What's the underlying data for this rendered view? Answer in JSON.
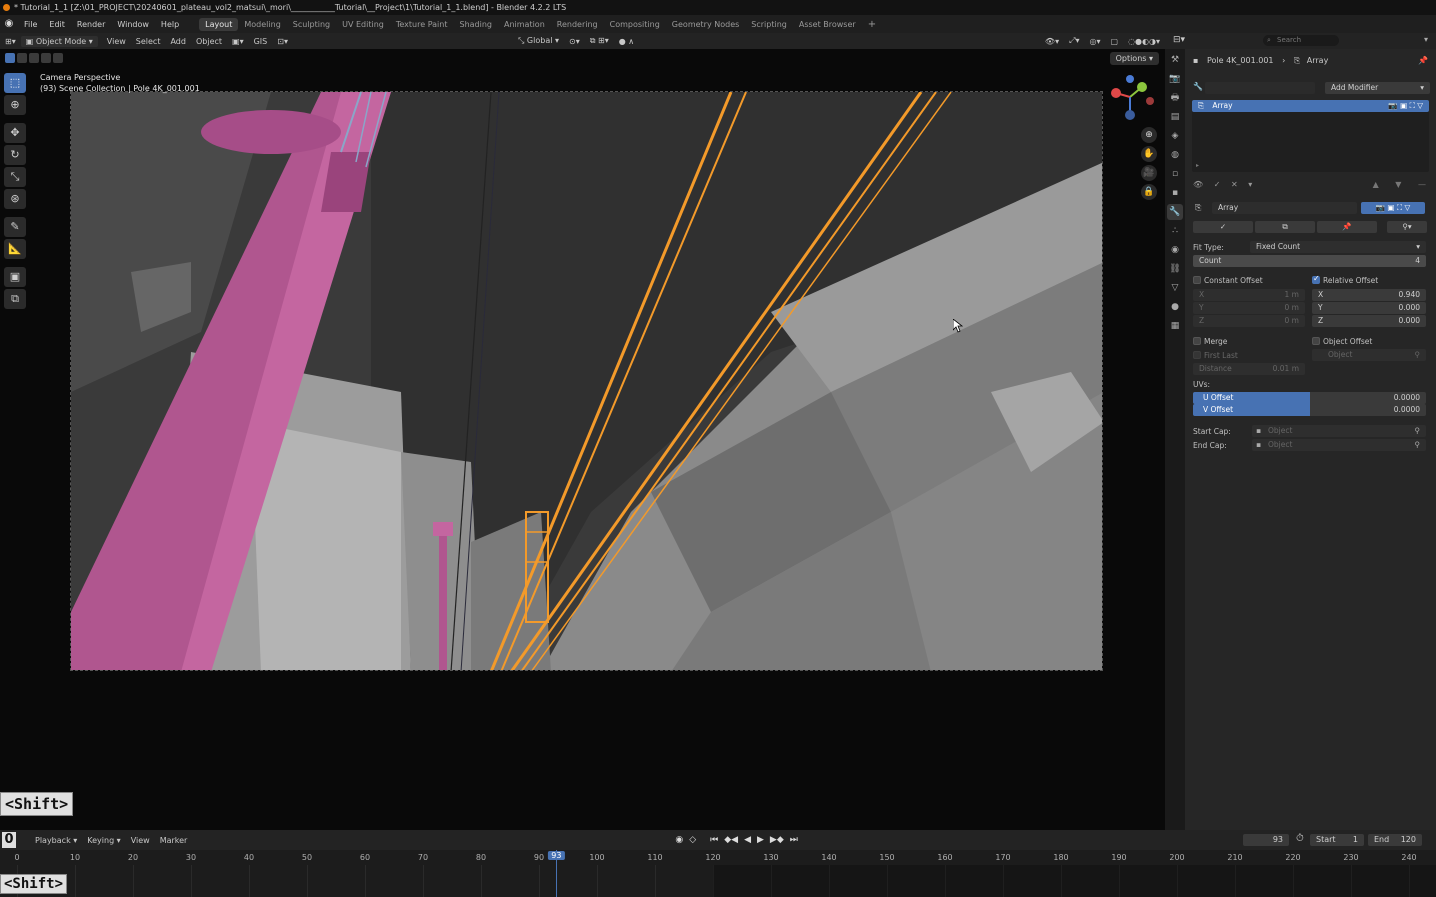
{
  "titlebar": {
    "title": "* Tutorial_1_1 [Z:\\01_PROJECT\\20240601_plateau_vol2_matsui\\_mori\\___________Tutorial\\__Project\\1\\Tutorial_1_1.blend] - Blender 4.2.2 LTS"
  },
  "menu": [
    "File",
    "Edit",
    "Render",
    "Window",
    "Help"
  ],
  "workspaces": [
    "Layout",
    "Modeling",
    "Sculpting",
    "UV Editing",
    "Texture Paint",
    "Shading",
    "Animation",
    "Rendering",
    "Compositing",
    "Geometry Nodes",
    "Scripting",
    "Asset Browser"
  ],
  "active_workspace": "Layout",
  "viewport_header": {
    "mode": "Object Mode",
    "menus": [
      "View",
      "Select",
      "Add",
      "Object",
      "GIS"
    ],
    "orientation": "Global",
    "options": "Options"
  },
  "viewport": {
    "info_line1": "Camera Perspective",
    "info_line2": "(93) Scene Collection | Pole 4K_001.001"
  },
  "outliner_header": {
    "search_placeholder": "Search"
  },
  "properties": {
    "breadcrumb_object": "Pole 4K_001.001",
    "breadcrumb_modifier": "Array",
    "add_modifier": "Add Modifier",
    "stack_item": "Array",
    "modifier_name": "Array",
    "fit_type_label": "Fit Type:",
    "fit_type_value": "Fixed Count",
    "count_label": "Count",
    "count_value": "4",
    "constant_offset": "Constant Offset",
    "relative_offset": "Relative Offset",
    "const_x_label": "X",
    "const_x_value": "1 m",
    "const_y_label": "Y",
    "const_y_value": "0 m",
    "const_z_label": "Z",
    "const_z_value": "0 m",
    "rel_x_label": "X",
    "rel_x_value": "0.940",
    "rel_y_label": "Y",
    "rel_y_value": "0.000",
    "rel_z_label": "Z",
    "rel_z_value": "0.000",
    "merge": "Merge",
    "first_last": "First Last",
    "distance_label": "Distance",
    "distance_value": "0.01 m",
    "object_offset": "Object Offset",
    "object_placeholder": "Object",
    "uvs_label": "UVs:",
    "u_offset_label": "U Offset",
    "u_offset_value": "0.0000",
    "v_offset_label": "V Offset",
    "v_offset_value": "0.0000",
    "start_cap_label": "Start Cap:",
    "start_cap_value": "Object",
    "end_cap_label": "End Cap:",
    "end_cap_value": "Object"
  },
  "timeline": {
    "menus": [
      "Playback",
      "Keying",
      "View",
      "Marker"
    ],
    "current_frame": "93",
    "start_label": "Start",
    "start_value": "1",
    "end_label": "End",
    "end_value": "120",
    "ticks": [
      "0",
      "10",
      "20",
      "30",
      "40",
      "50",
      "60",
      "70",
      "80",
      "90",
      "100",
      "110",
      "120",
      "130",
      "140",
      "150",
      "160",
      "170",
      "180",
      "190",
      "200",
      "210",
      "220",
      "230",
      "240"
    ]
  },
  "overlay_keys": {
    "key1": "<Shift>",
    "key2": "<Shift>",
    "digit": "0"
  }
}
